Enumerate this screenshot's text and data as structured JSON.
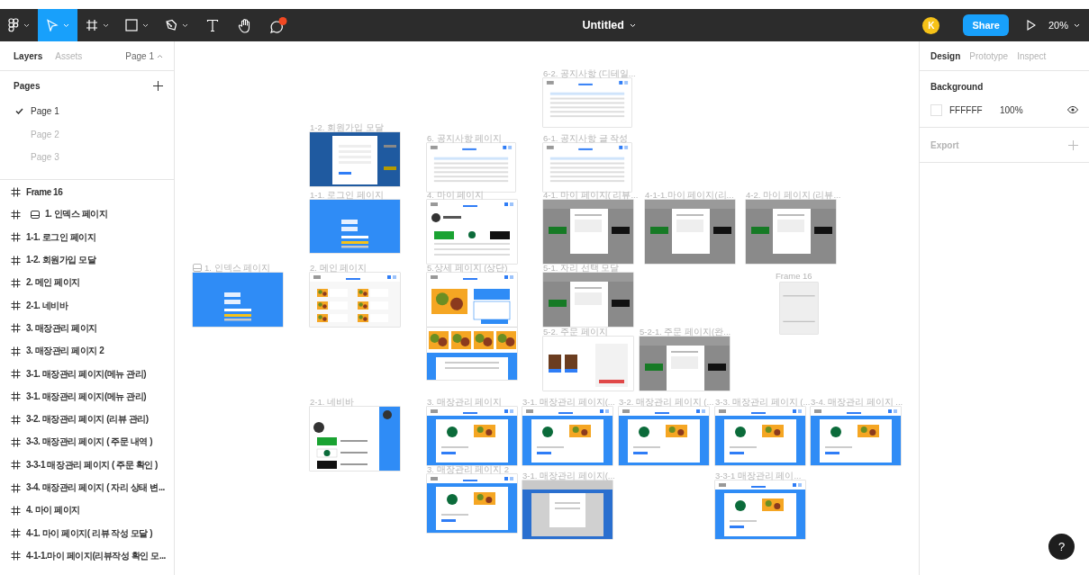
{
  "toolbar": {
    "tools": [
      {
        "kind": "logo",
        "menu": true,
        "selected": false
      },
      {
        "kind": "move",
        "menu": true,
        "selected": true
      },
      {
        "kind": "frame",
        "menu": true,
        "selected": false
      },
      {
        "kind": "rect",
        "menu": true,
        "selected": false
      },
      {
        "kind": "pen",
        "menu": true,
        "selected": false
      },
      {
        "kind": "text",
        "menu": false,
        "selected": false
      },
      {
        "kind": "hand",
        "menu": false,
        "selected": false
      },
      {
        "kind": "comment",
        "menu": false,
        "selected": false,
        "notification": true
      }
    ],
    "title": "Untitled",
    "avatar": "K",
    "share": "Share",
    "zoom": "20%"
  },
  "left_panel": {
    "tabs": [
      {
        "label": "Layers",
        "selected": true
      },
      {
        "label": "Assets",
        "selected": false
      }
    ],
    "page_menu": "Page 1",
    "pages_title": "Pages",
    "pages": [
      {
        "label": "Page 1",
        "selected": true
      },
      {
        "label": "Page 2",
        "selected": false
      },
      {
        "label": "Page 3",
        "selected": false
      }
    ],
    "layers": [
      {
        "name": "Frame 16",
        "marked": false
      },
      {
        "name": "1. 인덱스 페이지",
        "marked": true
      },
      {
        "name": "1-1. 로그인 페이지",
        "marked": false
      },
      {
        "name": "1-2. 회원가입 모달",
        "marked": false
      },
      {
        "name": "2. 메인 페이지",
        "marked": false
      },
      {
        "name": "2-1. 네비바",
        "marked": false
      },
      {
        "name": "3. 매장관리 페이지",
        "marked": false
      },
      {
        "name": "3. 매장관리 페이지 2",
        "marked": false
      },
      {
        "name": "3-1. 매장관리 페이지(메뉴 관리)",
        "marked": false
      },
      {
        "name": "3-1. 매장관리 페이지(메뉴 관리)",
        "marked": false
      },
      {
        "name": "3-2. 매장관리 페이지 (리뷰 관리)",
        "marked": false
      },
      {
        "name": "3-3. 매장관리 페이지 ( 주문 내역 )",
        "marked": false
      },
      {
        "name": "3-3-1 매장관리 페이지 ( 주문 확인 )",
        "marked": false
      },
      {
        "name": "3-4. 매장관리 페이지 ( 자리 상태 변...",
        "marked": false
      },
      {
        "name": "4. 마이 페이지",
        "marked": false
      },
      {
        "name": "4-1. 마이 페이지( 리뷰 작성 모달 )",
        "marked": false
      },
      {
        "name": "4-1-1.마이 페이지(리뷰작성 확인 모...",
        "marked": false
      }
    ]
  },
  "canvas": {
    "frames": [
      {
        "label": "1. 인덱스 페이지",
        "marked": true,
        "kind": "blue"
      },
      {
        "label": "1-2. 회원가입 모달",
        "marked": false,
        "kind": "signup"
      },
      {
        "label": "1-1. 로그인 페이지",
        "marked": false,
        "kind": "blue"
      },
      {
        "label": "2. 메인 페이지",
        "marked": false,
        "kind": "food"
      },
      {
        "label": "2-1. 네비바",
        "marked": false,
        "kind": "navbar"
      },
      {
        "label": "6. 공지사항 페이지",
        "marked": false,
        "kind": "doc"
      },
      {
        "label": "4. 마이 페이지",
        "marked": false,
        "kind": "mypage"
      },
      {
        "label": "5.상세 페이지 (상단)",
        "marked": false,
        "kind": "detail"
      },
      {
        "label": "6-2. 공지사항 (디테일...",
        "marked": false,
        "kind": "doc"
      },
      {
        "label": "6-1. 공지사항 글 작성",
        "marked": false,
        "kind": "doc"
      },
      {
        "label": "4-1. 마이 페이지( 리뷰...",
        "marked": false,
        "kind": "gray"
      },
      {
        "label": "4-1-1.마이 페이지(리...",
        "marked": false,
        "kind": "gray"
      },
      {
        "label": "4-2. 마이 페이지 (리뷰...",
        "marked": false,
        "kind": "gray"
      },
      {
        "label": "5-1. 자리 선택 모달",
        "marked": false,
        "kind": "gray"
      },
      {
        "label": "Frame 16",
        "marked": false,
        "kind": "paper"
      },
      {
        "label": "5-2. 주문 페이지",
        "marked": false,
        "kind": "order"
      },
      {
        "label": "5-2-1. 주문 페이지(완...",
        "marked": false,
        "kind": "gray"
      },
      {
        "label": "3. 매장관리 페이지",
        "marked": false,
        "kind": "admin"
      },
      {
        "label": "3-1. 매장관리 페이지(...",
        "marked": false,
        "kind": "admin"
      },
      {
        "label": "3-2. 매장관리 페이지 (...",
        "marked": false,
        "kind": "admin"
      },
      {
        "label": "3-3. 매장관리 페이지 (...",
        "marked": false,
        "kind": "admin"
      },
      {
        "label": "3-4. 매장관리 페이지 ...",
        "marked": false,
        "kind": "admin"
      },
      {
        "label": "3. 매장관리 페이지 2",
        "marked": false,
        "kind": "admin"
      },
      {
        "label": "3-1. 매장관리 페이지(...",
        "marked": false,
        "kind": "admin-modal"
      },
      {
        "label": "3-3-1 매장관리 페이...",
        "marked": false,
        "kind": "admin"
      },
      {
        "kind": "food-strip"
      }
    ]
  },
  "right_panel": {
    "tabs": [
      {
        "label": "Design",
        "selected": true
      },
      {
        "label": "Prototype",
        "selected": false
      },
      {
        "label": "Inspect",
        "selected": false
      }
    ],
    "background_title": "Background",
    "color_hex": "FFFFFF",
    "opacity": "100%",
    "visible": true,
    "export_title": "Export",
    "help": "?"
  }
}
